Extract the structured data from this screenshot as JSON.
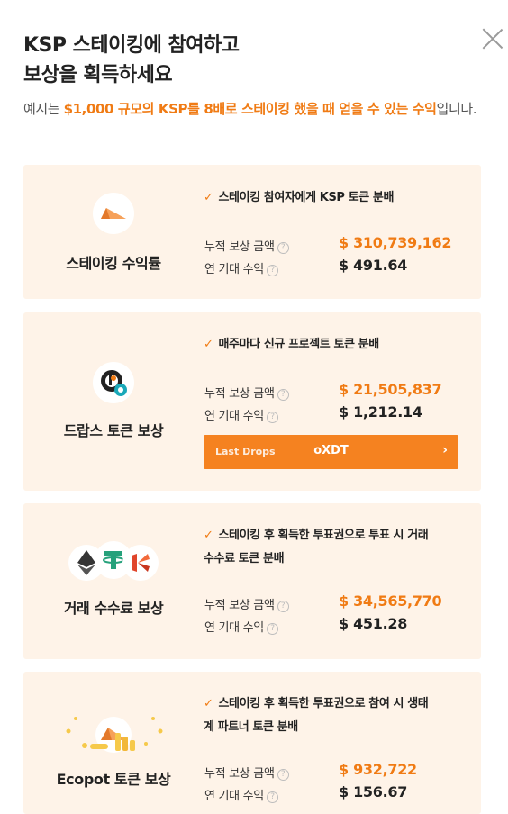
{
  "modal": {
    "title_line1": "KSP 스테이킹에 참여하고",
    "title_line2": "보상을 획득하세요",
    "subtitle": {
      "pre": "예시는 ",
      "amount": "$1,000 규모의 KSP를 8배로 스테이킹 했을 때 얻을 수 있는 수익",
      "post": "입니다."
    }
  },
  "labels": {
    "accumulated": "누적 보상 금액",
    "annual": "연 기대 수익",
    "help_glyph": "?",
    "check_glyph": "✓"
  },
  "cards": [
    {
      "name": "스테이킹 수익률",
      "icon": "ksp-triangle-icon",
      "desc": "스테이킹 참여자에게 KSP 토큰 분배",
      "accumulated_value": "$ 310,739,162",
      "annual_value": "$ 491.64"
    },
    {
      "name": "드랍스 토큰 보상",
      "icon": "drops-token-icon",
      "desc": "매주마다 신규 프로젝트 토큰 분배",
      "accumulated_value": "$ 21,505,837",
      "annual_value": "$ 1,212.14",
      "button": {
        "label": "Last Drops",
        "token": "oXDT",
        "chevron": "›"
      }
    },
    {
      "name": "거래 수수료 보상",
      "icon": "eth-usdt-klay-icons",
      "desc_line1": "스테이킹 후 획득한 투표권으로 투표 시 거래",
      "desc_line2": "수수료 토큰 분배",
      "accumulated_value": "$ 34,565,770",
      "annual_value": "$ 451.28"
    },
    {
      "name": "Ecopot 토큰 보상",
      "icon": "ecopot-coins-icon",
      "desc_line1": "스테이킹 후 획득한 투표권으로 참여 시 생태",
      "desc_line2": "계 파트너 토큰 분배",
      "accumulated_value": "$ 932,722",
      "annual_value": "$ 156.67"
    }
  ],
  "colors": {
    "accent": "#f07b14",
    "card_bg": "#fef3e8",
    "button_bg": "#f58220"
  }
}
